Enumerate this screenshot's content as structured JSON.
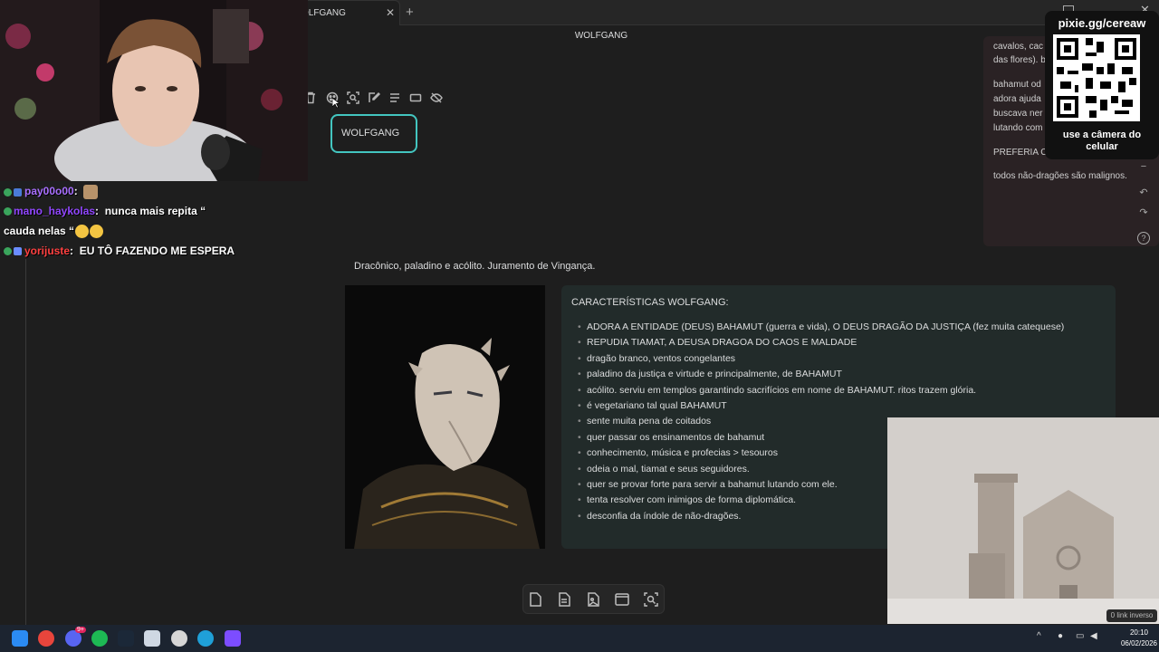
{
  "window": {
    "tab_title": "OLFGANG",
    "tab_close": "✕",
    "tab_add": "+",
    "header_title": "WOLFGANG",
    "close_glyph": "✕"
  },
  "chat": [
    {
      "user": "pay00o00",
      "user_color": "#a970ff",
      "message": ""
    },
    {
      "user": "mano_haykolas",
      "user_color": "#9146ff",
      "message": "nunca mais repita “"
    },
    {
      "user": "",
      "user_color": "#ffffff",
      "message": "cauda nelas “"
    },
    {
      "user": "yorijuste",
      "user_color": "#ff4040",
      "message": "EU TÔ FAZENDO ME ESPERA"
    }
  ],
  "canvas": {
    "toolbar_icons": [
      "trash-icon",
      "palette-icon",
      "zoom-fit-icon",
      "edit-icon",
      "align-icon",
      "card-icon",
      "hide-icon"
    ],
    "node_label": "WOLFGANG",
    "description": "Dracônico, paladino e acólito. Juramento de Vingança.",
    "bottom_toolbar_icons": [
      "new-card-icon",
      "new-note-icon",
      "add-media-icon",
      "group-icon",
      "zoom-fit-icon"
    ]
  },
  "note_card": {
    "lines": [
      "cavalos, cac",
      "das flores). b",
      "bahamut od",
      "adora ajuda",
      "buscava ner",
      "lutando com",
      "PREFERIA C",
      "todos não-dragões são malignos."
    ]
  },
  "qr_overlay": {
    "url": "pixie.gg/cereaw",
    "caption": "use a câmera do celular"
  },
  "side_controls": [
    "−",
    "↶",
    "↷",
    "?"
  ],
  "characteristics": {
    "title": "CARACTERÍSTICAS WOLFGANG:",
    "items": [
      "ADORA A ENTIDADE (DEUS) BAHAMUT (guerra e vida), O DEUS DRAGÃO DA JUSTIÇA (fez muita catequese)",
      "REPUDIA TIAMAT, A DEUSA DRAGOA DO CAOS E MALDADE",
      "dragão branco, ventos congelantes",
      "paladino da justiça e virtude e principalmente, de BAHAMUT",
      "acólito. serviu em templos garantindo sacrifícios em nome de BAHAMUT. ritos trazem glória.",
      "é vegetariano tal qual BAHAMUT",
      "sente muita pena de coitados",
      "quer passar os ensinamentos de bahamut",
      "conhecimento, música e profecias > tesouros",
      "odeia o mal, tiamat e seus seguidores.",
      "quer se provar forte para servir a bahamut lutando com ele.",
      "tenta resolver com inimigos de forma diplomática.",
      "desconfia da índole de não-dragões."
    ]
  },
  "backlinks": "0 link inverso",
  "taskbar": {
    "time": "20:10",
    "date": "06/02/2026",
    "discord_badge": "9+",
    "colors": {
      "bg": "#1c2430"
    }
  },
  "colors": {
    "accent": "#43c6c0",
    "card_bg": "#222b2a",
    "note_bg": "#2a2224"
  }
}
